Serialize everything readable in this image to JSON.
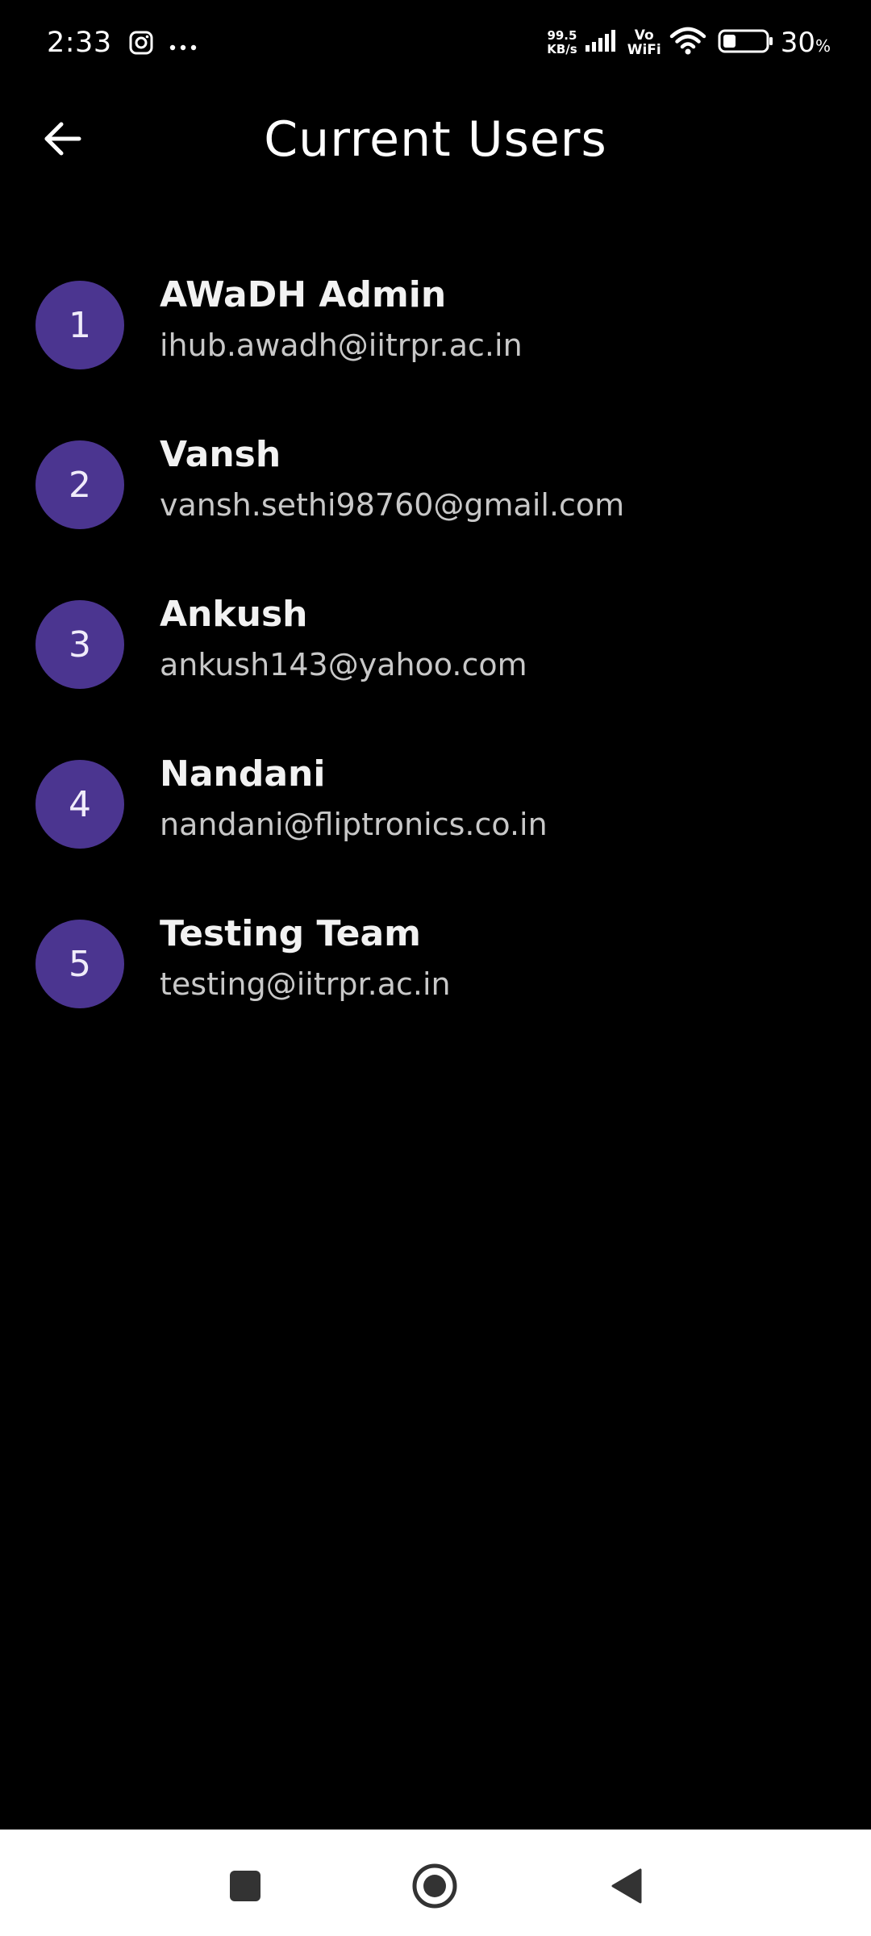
{
  "status_bar": {
    "time": "2:33",
    "net_speed_value": "99.5",
    "net_speed_unit": "KB/s",
    "vo": "Vo",
    "wifi": "WiFi",
    "battery_percent": "30",
    "battery_unit": "%",
    "battery_level": 0.3,
    "icons": [
      "instagram-icon",
      "more-dots-icon",
      "signal-icon",
      "wifi-icon",
      "battery-icon"
    ]
  },
  "header": {
    "title": "Current Users",
    "back_icon": "arrow-left-icon"
  },
  "colors": {
    "background": "#000000",
    "avatar": "#4b3590",
    "name_text": "#f2f2f2",
    "email_text": "#c8c8c8",
    "nav_bar": "#ffffff"
  },
  "users": [
    {
      "number": "1",
      "name": "AWaDH Admin",
      "email": "ihub.awadh@iitrpr.ac.in"
    },
    {
      "number": "2",
      "name": "Vansh",
      "email": "vansh.sethi98760@gmail.com"
    },
    {
      "number": "3",
      "name": "Ankush",
      "email": "ankush143@yahoo.com"
    },
    {
      "number": "4",
      "name": "Nandani",
      "email": "nandani@fliptronics.co.in"
    },
    {
      "number": "5",
      "name": "Testing Team",
      "email": "testing@iitrpr.ac.in"
    }
  ],
  "nav_bar": {
    "icons": [
      "recents-square-icon",
      "home-circle-icon",
      "back-triangle-icon"
    ]
  }
}
